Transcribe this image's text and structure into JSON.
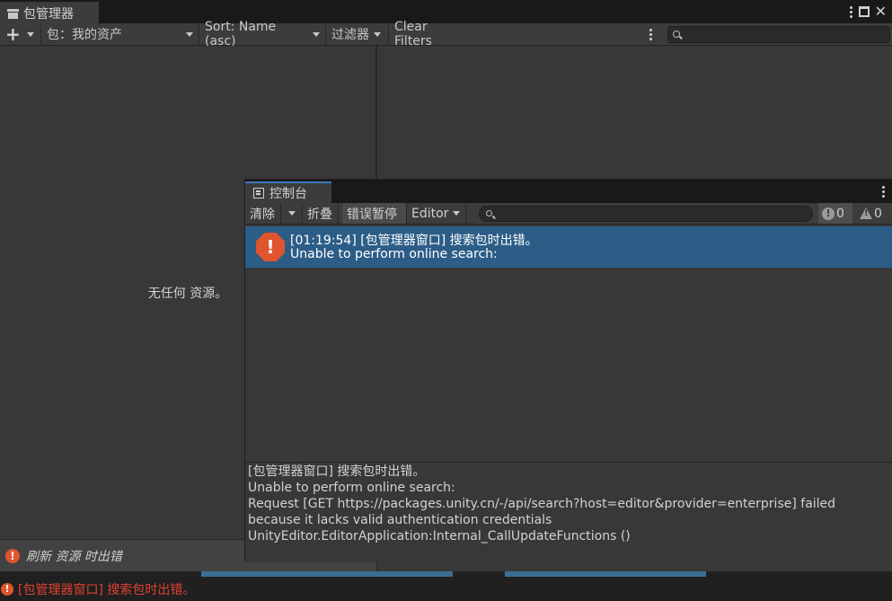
{
  "package_manager": {
    "tab_title": "包管理器",
    "toolbar": {
      "add_symbol": "+",
      "packages_label": "包：我的资产",
      "sort_label": "Sort: Name (asc)",
      "filters_label": "过滤器",
      "clear_filters_label": "Clear Filters"
    },
    "search": {
      "placeholder": "",
      "value": ""
    },
    "empty_message": "无任何 资源。",
    "status_text": "刷新 资源 时出错"
  },
  "console": {
    "tab_title": "控制台",
    "toolbar": {
      "clear_label": "清除",
      "collapse_label": "折叠",
      "error_pause_label": "错误暂停",
      "editor_label": "Editor",
      "error_count": "0",
      "warning_count": "0"
    },
    "search": {
      "placeholder": "",
      "value": ""
    },
    "entries": [
      {
        "line1": "[01:19:54] [包管理器窗口] 搜索包时出错。",
        "line2": "Unable to perform online search:",
        "selected": true
      }
    ],
    "detail_lines": [
      "[包管理器窗口] 搜索包时出错。",
      "Unable to perform online search:",
      "  Request [GET https://packages.unity.cn/-/api/search?host=editor&provider=enterprise] failed",
      "because it lacks valid authentication credentials",
      "UnityEditor.EditorApplication:Internal_CallUpdateFunctions ()"
    ]
  },
  "status_bar": {
    "message": "[包管理器窗口] 搜索包时出错。"
  },
  "colors": {
    "error_red": "#e0542e",
    "selection_blue": "#2c5d87",
    "active_tab_accent": "#3a79bb",
    "status_text_red": "#e0422f"
  },
  "icons": {
    "package_tab": "package-icon",
    "console_tab": "console-list-icon",
    "error": "error-octagon-icon",
    "warning": "warning-triangle-icon",
    "search": "search-icon"
  }
}
